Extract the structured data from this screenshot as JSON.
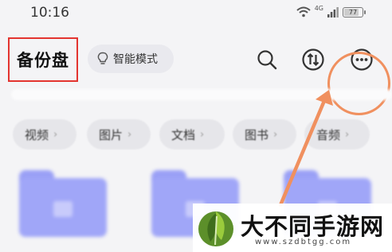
{
  "status_bar": {
    "time": "10:16",
    "signal_label": "4G",
    "battery_level": "77",
    "battery_fraction": 0.77
  },
  "header": {
    "title": "备份盘",
    "mode_chip_label": "智能模式"
  },
  "categories": [
    {
      "label": "视频"
    },
    {
      "label": "图片"
    },
    {
      "label": "文档"
    },
    {
      "label": "图书"
    },
    {
      "label": "音频"
    }
  ],
  "icons": {
    "search": "search-icon",
    "transfer": "transfer-icon",
    "more": "more-icon",
    "mode": "lightbulb-icon"
  },
  "annotation": {
    "highlight_color": "#e3342f",
    "arrow_color": "#f0905f"
  },
  "watermark": {
    "title": "大不同手游网",
    "url": "www.szdbtgg.com"
  },
  "colors": {
    "folder": "#a0a6f8",
    "background": "#f4f4f6"
  }
}
